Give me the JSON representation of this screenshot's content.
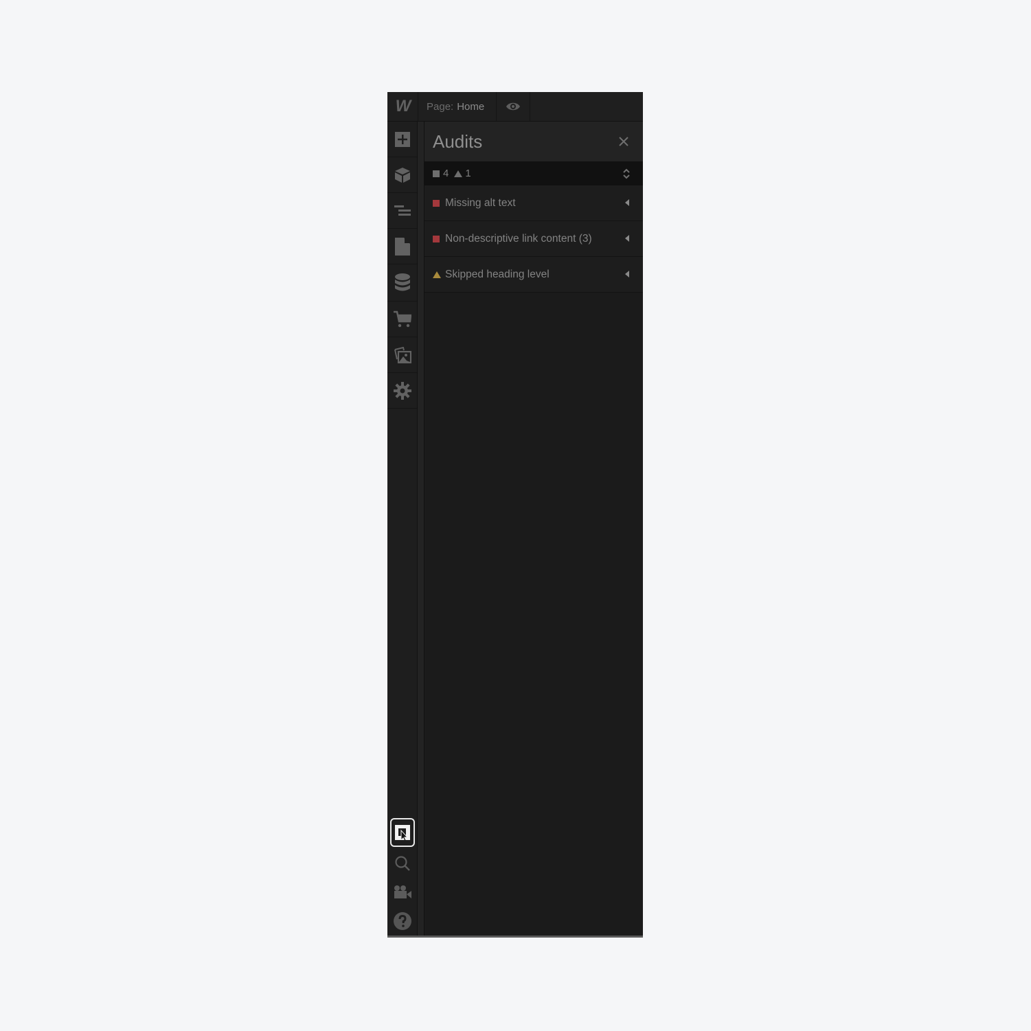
{
  "topbar": {
    "logo": "W",
    "page_key": "Page:",
    "page_value": "Home",
    "preview_icon": "eye-icon"
  },
  "sidebar": {
    "items": [
      {
        "name": "add-elements",
        "icon": "plus-square-icon"
      },
      {
        "name": "components",
        "icon": "cube-icon"
      },
      {
        "name": "navigator",
        "icon": "navigator-lines-icon"
      },
      {
        "name": "pages",
        "icon": "page-icon"
      },
      {
        "name": "cms",
        "icon": "database-icon"
      },
      {
        "name": "ecommerce",
        "icon": "cart-icon"
      },
      {
        "name": "assets",
        "icon": "images-icon"
      },
      {
        "name": "settings",
        "icon": "gear-icon"
      }
    ],
    "bottom_items": [
      {
        "name": "audits",
        "icon": "audit-icon",
        "active": true
      },
      {
        "name": "search",
        "icon": "search-icon"
      },
      {
        "name": "video-tutorials",
        "icon": "video-camera-icon"
      },
      {
        "name": "help",
        "icon": "help-icon"
      }
    ]
  },
  "panel": {
    "title": "Audits",
    "summary": {
      "error_count": "4",
      "warning_count": "1"
    },
    "colors": {
      "error": "#a3383c",
      "warning": "#a88a3c"
    },
    "audits": [
      {
        "label": "Missing alt text",
        "severity": "error"
      },
      {
        "label": "Non-descriptive link content (3)",
        "severity": "error"
      },
      {
        "label": "Skipped heading level",
        "severity": "warning"
      }
    ]
  }
}
